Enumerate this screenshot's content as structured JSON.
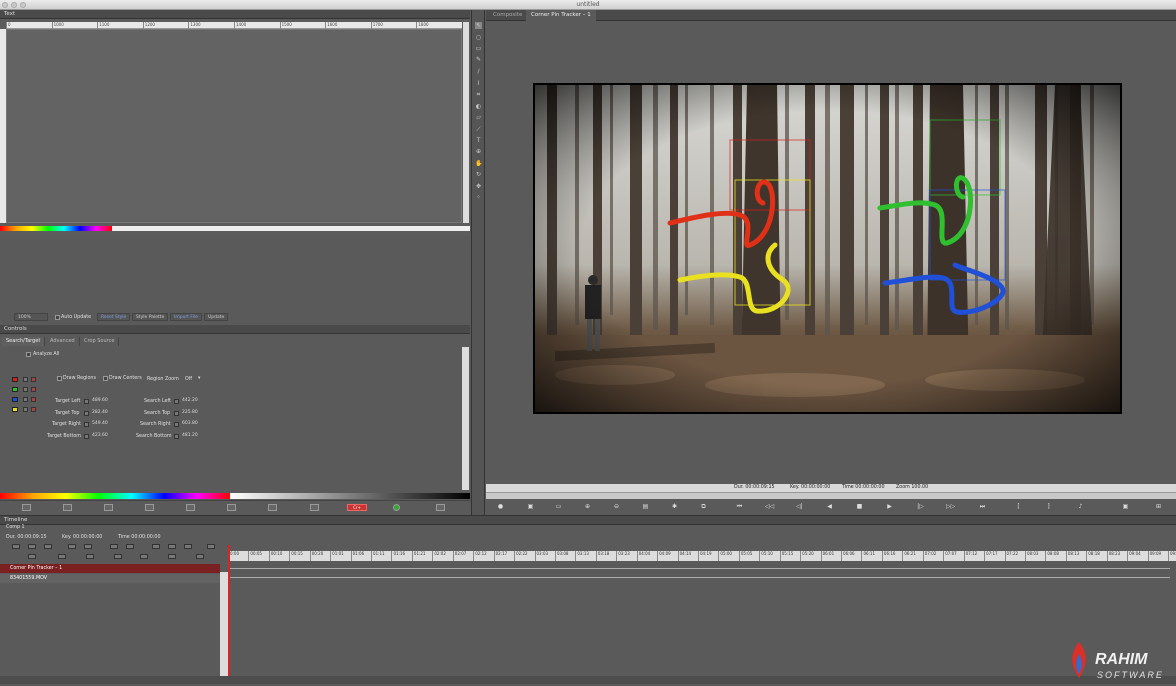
{
  "window": {
    "title": "untitled"
  },
  "text_panel": {
    "tab": "Text",
    "ruler_ticks": [
      "0",
      "1000",
      "1100",
      "1200",
      "1300",
      "1400",
      "1500",
      "1600",
      "1700",
      "1800"
    ],
    "toolbar": {
      "zoom": "100%",
      "auto_update": "Auto Update",
      "reset_style": "Reset Style",
      "style_palette": "Style Palette",
      "import_file": "Import File",
      "update": "Update"
    }
  },
  "controls": {
    "tab": "Controls",
    "subtabs": [
      "Search/Target",
      "Advanced",
      "Crop Source"
    ],
    "analyze_all": "Analyze All",
    "draw_regions": "Draw Regions",
    "draw_centers": "Draw Centers",
    "region_zoom_label": "Region Zoom",
    "region_zoom_value": "Off",
    "trackers": [
      "#d92020",
      "#2fbf2f",
      "#2050d8",
      "#e8e020"
    ],
    "fields_left": [
      {
        "label": "Target Left",
        "value": "489.60"
      },
      {
        "label": "Target Top",
        "value": "282.40"
      },
      {
        "label": "Target Right",
        "value": "549.40"
      },
      {
        "label": "Target Bottom",
        "value": "423.60"
      }
    ],
    "fields_right": [
      {
        "label": "Search Left",
        "value": "442.20"
      },
      {
        "label": "Search Top",
        "value": "225.80"
      },
      {
        "label": "Search Right",
        "value": "603.80"
      },
      {
        "label": "Search Bottom",
        "value": "481.20"
      }
    ],
    "bottom_red_label": "Cr+"
  },
  "viewer": {
    "tabs": [
      "Composite",
      "Corner Pin Tracker – 1"
    ],
    "status": {
      "dur": "Dur. 00:00:09:15",
      "key": "Key. 00:00:00:00",
      "time": "Time 00:00:00:00",
      "zoom": "Zoom 100.00"
    }
  },
  "timeline": {
    "tab": "Timeline",
    "comp": "Comp 1",
    "dur": "Dur. 00:00:09:15",
    "key": "Key. 00:00:00:00",
    "time": "Time 00:00:00:00",
    "ticks": [
      "0:00",
      "00:05",
      "00:10",
      "00:15",
      "00:20",
      "01:01",
      "01:06",
      "01:11",
      "01:16",
      "01:21",
      "02:02",
      "02:07",
      "02:12",
      "02:17",
      "02:22",
      "03:03",
      "03:08",
      "03:13",
      "03:18",
      "03:23",
      "04:04",
      "04:09",
      "04:14",
      "04:19",
      "05:00",
      "05:05",
      "05:10",
      "05:15",
      "05:20",
      "06:01",
      "06:06",
      "06:11",
      "06:16",
      "06:21",
      "07:02",
      "07:07",
      "07:12",
      "07:17",
      "07:22",
      "08:03",
      "08:08",
      "08:13",
      "08:18",
      "08:23",
      "09:04",
      "09:09",
      "09:14"
    ],
    "tracks": [
      "Corner Pin Tracker – 1",
      "83401559.MOV"
    ]
  },
  "watermark": {
    "brand": "RAHIM",
    "sub": "SOFTWARE"
  }
}
